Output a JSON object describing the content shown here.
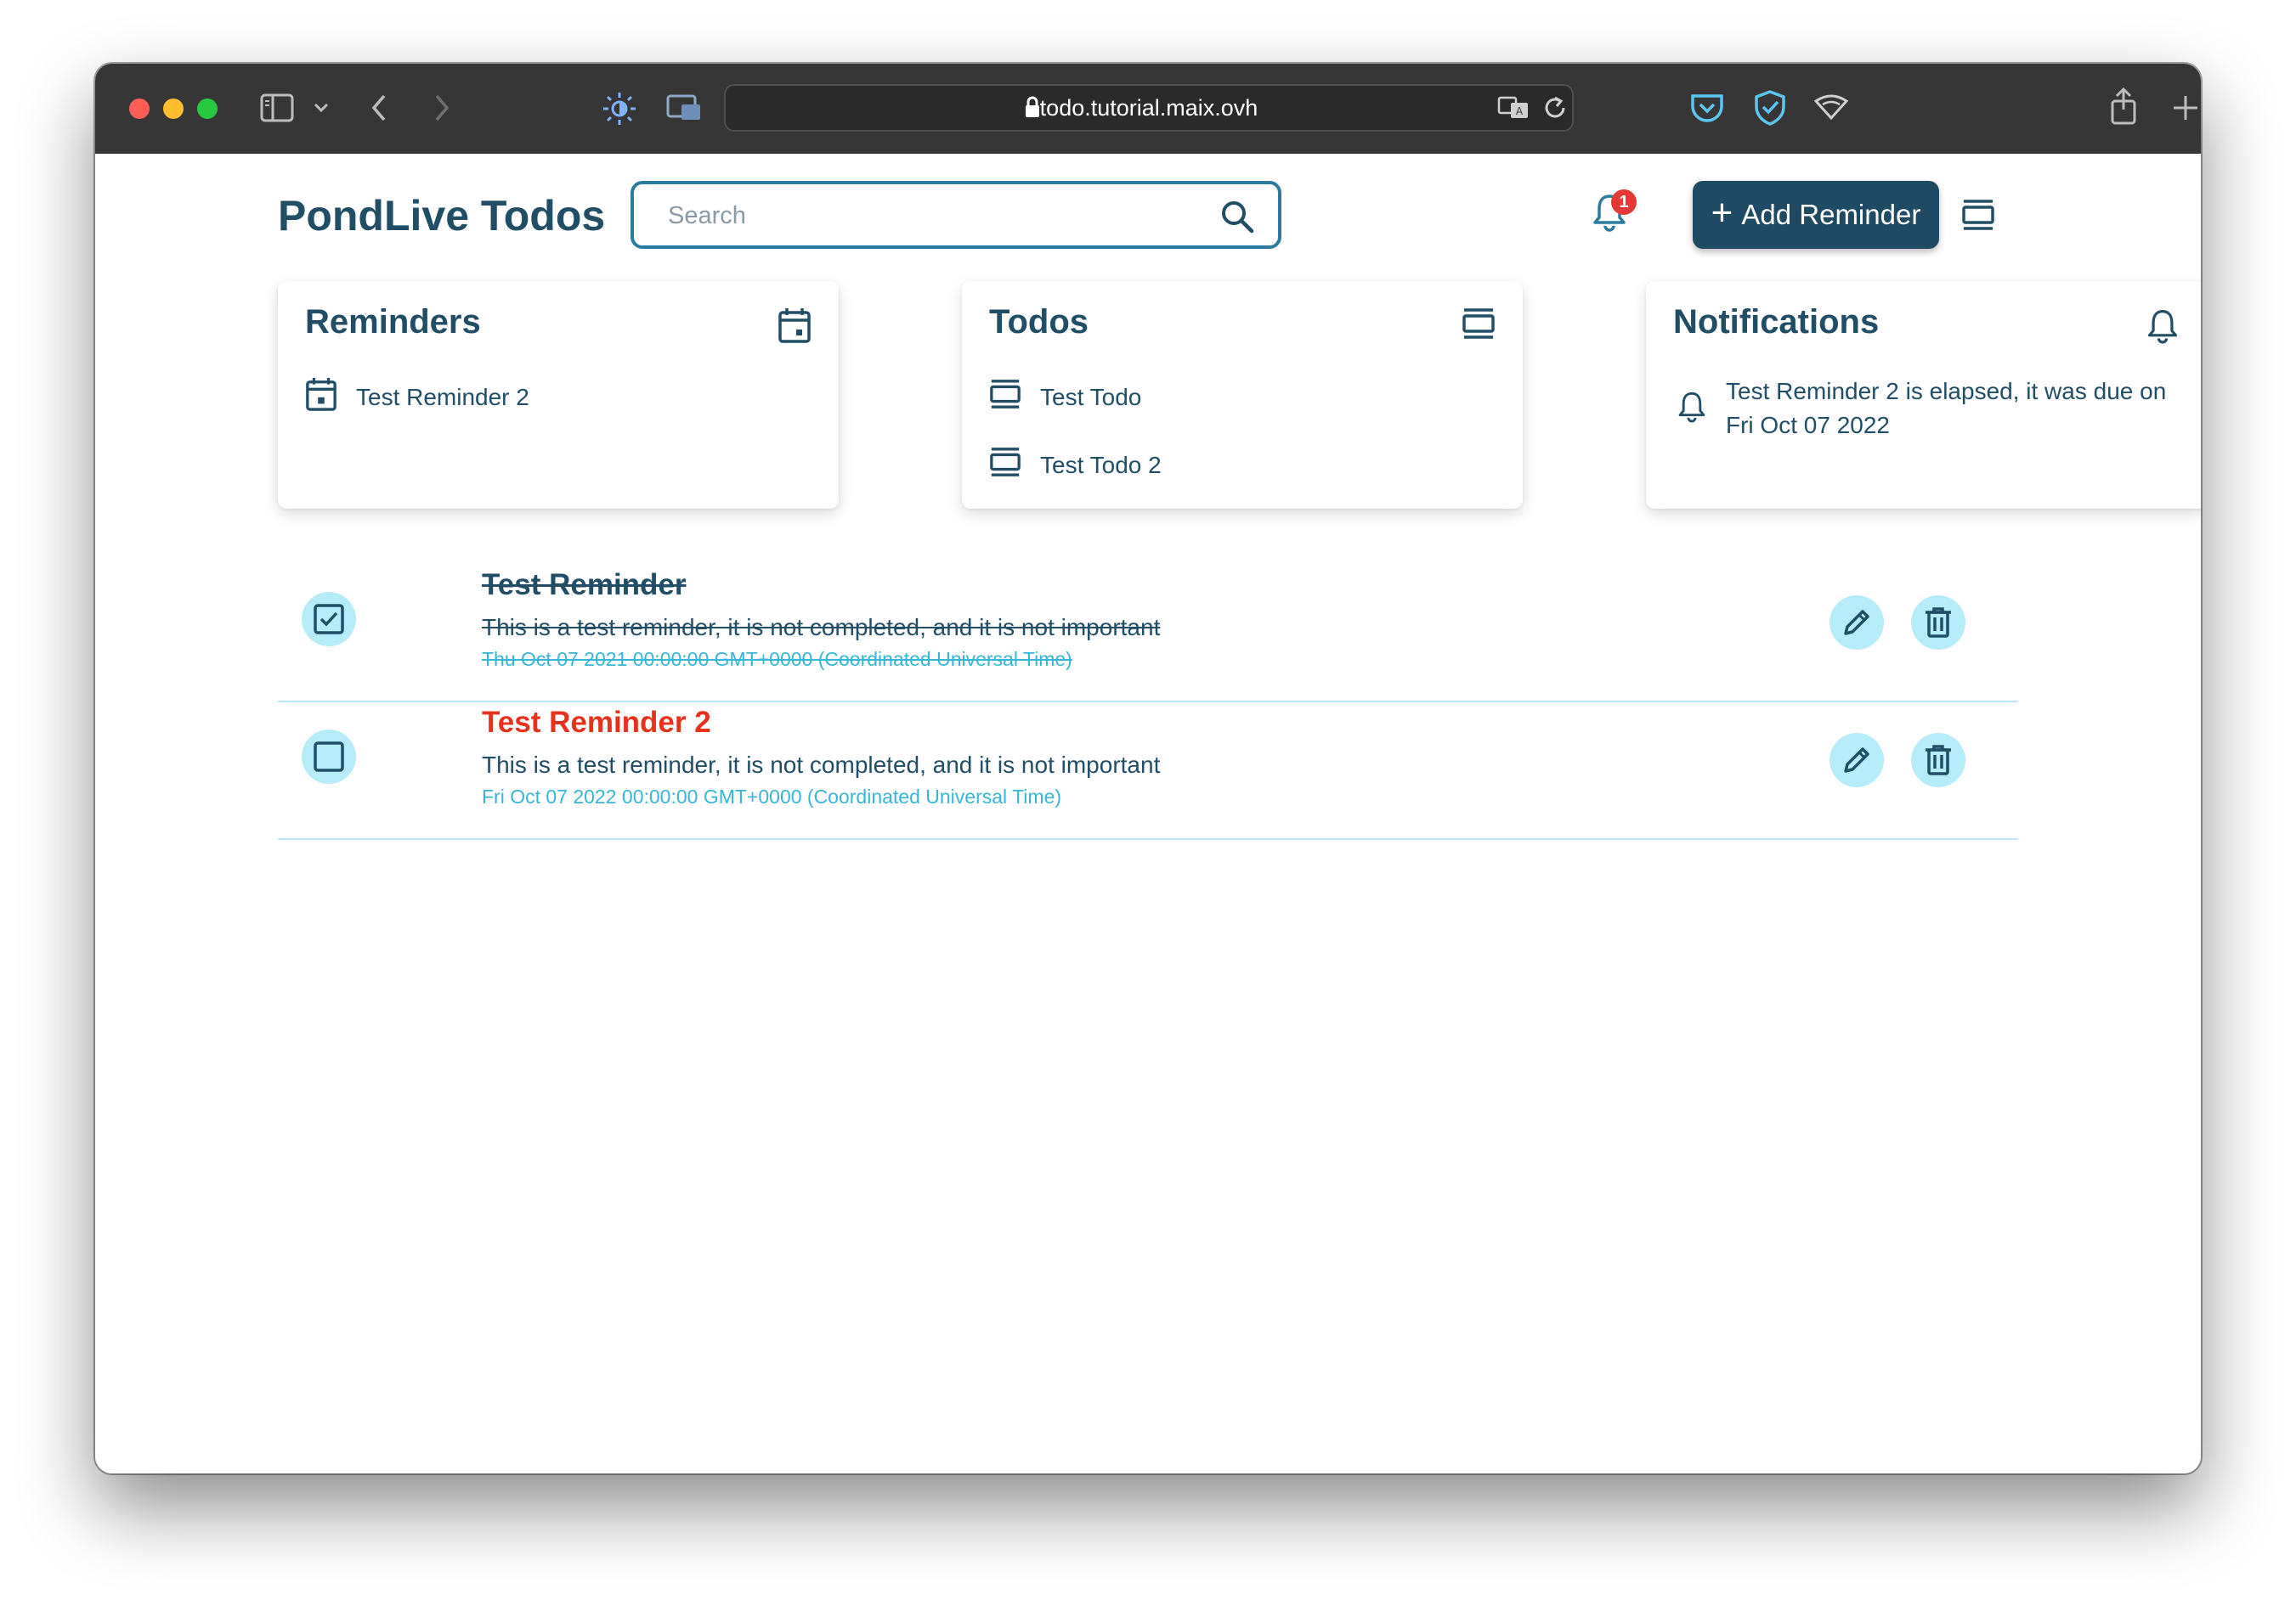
{
  "browser": {
    "url": "todo.tutorial.maix.ovh",
    "icons": [
      "sidebar-icon",
      "chevron-down-icon",
      "back-icon",
      "forward-icon",
      "brightness-icon",
      "picture-in-picture-icon",
      "lock-icon",
      "translate-icon",
      "reload-icon",
      "pocket-icon",
      "shield-icon",
      "wifi-extension-icon",
      "share-icon",
      "new-tab-icon",
      "tab-overview-icon"
    ]
  },
  "header": {
    "brand": "PondLive Todos",
    "search_placeholder": "Search",
    "notification_count": "1",
    "add_label": "Add Reminder"
  },
  "cards": {
    "reminders": {
      "title": "Reminders",
      "items": [
        {
          "label": "Test Reminder 2"
        }
      ]
    },
    "todos": {
      "title": "Todos",
      "items": [
        {
          "label": "Test Todo"
        },
        {
          "label": "Test Todo 2"
        }
      ]
    },
    "notifications": {
      "title": "Notifications",
      "items": [
        {
          "text": "Test Reminder 2 is elapsed, it was due on Fri Oct 07 2022"
        }
      ]
    }
  },
  "reminders": [
    {
      "title": "Test Reminder",
      "description": "This is a test reminder, it is not completed, and it is not important",
      "date": "Thu Oct 07 2021 00:00:00 GMT+0000 (Coordinated Universal Time)",
      "completed": true
    },
    {
      "title": "Test Reminder 2",
      "description": "This is a test reminder, it is not completed, and it is not important",
      "date": "Fri Oct 07 2022 00:00:00 GMT+0000 (Coordinated Universal Time)",
      "completed": false
    }
  ],
  "colors": {
    "primary": "#1f4e66",
    "accent": "#38b6d6",
    "overdue": "#e8311a",
    "button": "#1e4a63",
    "badge": "#e53935"
  }
}
